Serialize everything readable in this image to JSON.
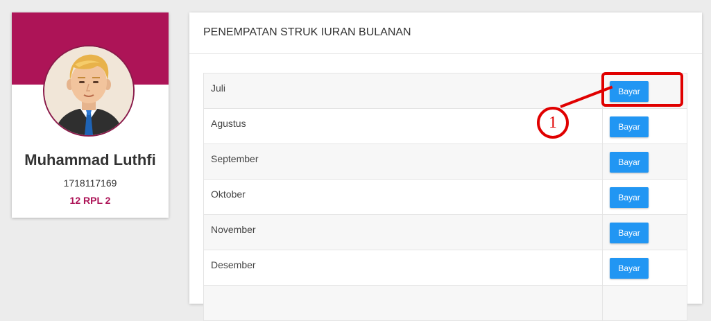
{
  "profile": {
    "name": "Muhammad Luthfi",
    "student_id": "1718117169",
    "class": "12 RPL 2",
    "avatar_icon": "avatar-icon",
    "banner_color": "#ad1457"
  },
  "panel": {
    "title": "PENEMPATAN STRUK IURAN BULANAN",
    "rows": [
      {
        "month": "Juli",
        "button": "Bayar"
      },
      {
        "month": "Agustus",
        "button": "Bayar"
      },
      {
        "month": "September",
        "button": "Bayar"
      },
      {
        "month": "Oktober",
        "button": "Bayar"
      },
      {
        "month": "November",
        "button": "Bayar"
      },
      {
        "month": "Desember",
        "button": "Bayar"
      },
      {
        "month": "",
        "button": ""
      }
    ]
  },
  "annotation": {
    "number": "1",
    "color": "#e00000"
  },
  "colors": {
    "button": "#2196f3",
    "accent": "#ad1457"
  }
}
